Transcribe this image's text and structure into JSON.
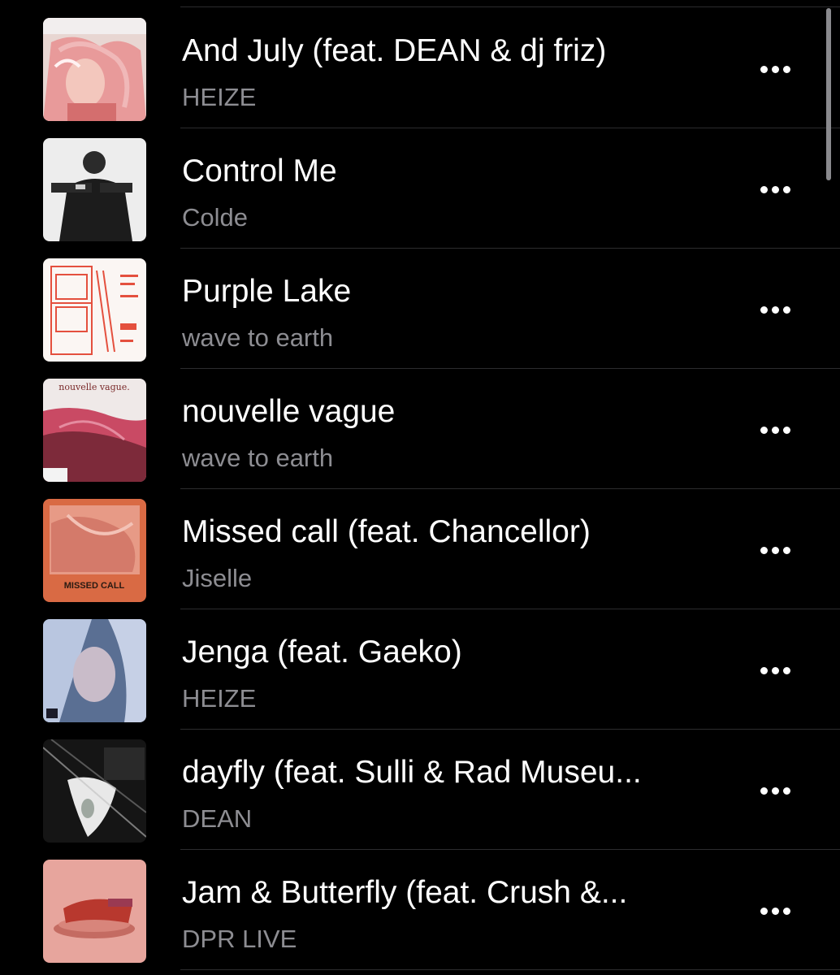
{
  "songs": [
    {
      "title": "And July (feat. DEAN & dj friz)",
      "artist": "HEIZE",
      "art_icon": "album-art-and-july"
    },
    {
      "title": "Control Me",
      "artist": "Colde",
      "art_icon": "album-art-control-me"
    },
    {
      "title": "Purple Lake",
      "artist": "wave to earth",
      "art_icon": "album-art-purple-lake"
    },
    {
      "title": "nouvelle vague",
      "artist": "wave to earth",
      "art_icon": "album-art-nouvelle-vague",
      "art_text": "nouvelle vague."
    },
    {
      "title": "Missed call (feat. Chancellor)",
      "artist": "Jiselle",
      "art_icon": "album-art-missed-call",
      "art_text": "MISSED CALL"
    },
    {
      "title": "Jenga (feat. Gaeko)",
      "artist": "HEIZE",
      "art_icon": "album-art-jenga"
    },
    {
      "title": "dayfly (feat. Sulli & Rad Museu...",
      "artist": "DEAN",
      "art_icon": "album-art-dayfly"
    },
    {
      "title": "Jam & Butterfly (feat. Crush &...",
      "artist": "DPR LIVE",
      "art_icon": "album-art-jam-butterfly"
    }
  ],
  "more_icon": "ellipsis-icon",
  "colors": {
    "background": "#000000",
    "title": "#ffffff",
    "subtitle": "#8d8d92",
    "divider": "#2c2c2e"
  }
}
